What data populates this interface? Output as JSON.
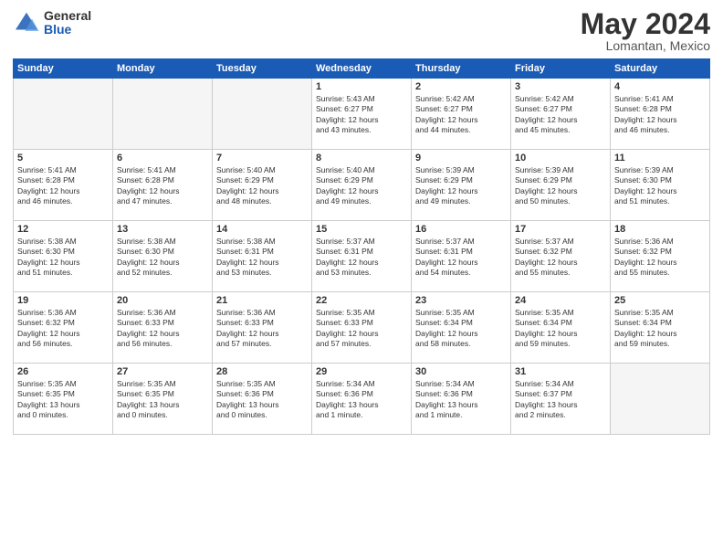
{
  "header": {
    "logo_general": "General",
    "logo_blue": "Blue",
    "title": "May 2024",
    "location": "Lomantan, Mexico"
  },
  "days_of_week": [
    "Sunday",
    "Monday",
    "Tuesday",
    "Wednesday",
    "Thursday",
    "Friday",
    "Saturday"
  ],
  "weeks": [
    [
      {
        "day": "",
        "info": ""
      },
      {
        "day": "",
        "info": ""
      },
      {
        "day": "",
        "info": ""
      },
      {
        "day": "1",
        "info": "Sunrise: 5:43 AM\nSunset: 6:27 PM\nDaylight: 12 hours\nand 43 minutes."
      },
      {
        "day": "2",
        "info": "Sunrise: 5:42 AM\nSunset: 6:27 PM\nDaylight: 12 hours\nand 44 minutes."
      },
      {
        "day": "3",
        "info": "Sunrise: 5:42 AM\nSunset: 6:27 PM\nDaylight: 12 hours\nand 45 minutes."
      },
      {
        "day": "4",
        "info": "Sunrise: 5:41 AM\nSunset: 6:28 PM\nDaylight: 12 hours\nand 46 minutes."
      }
    ],
    [
      {
        "day": "5",
        "info": "Sunrise: 5:41 AM\nSunset: 6:28 PM\nDaylight: 12 hours\nand 46 minutes."
      },
      {
        "day": "6",
        "info": "Sunrise: 5:41 AM\nSunset: 6:28 PM\nDaylight: 12 hours\nand 47 minutes."
      },
      {
        "day": "7",
        "info": "Sunrise: 5:40 AM\nSunset: 6:29 PM\nDaylight: 12 hours\nand 48 minutes."
      },
      {
        "day": "8",
        "info": "Sunrise: 5:40 AM\nSunset: 6:29 PM\nDaylight: 12 hours\nand 49 minutes."
      },
      {
        "day": "9",
        "info": "Sunrise: 5:39 AM\nSunset: 6:29 PM\nDaylight: 12 hours\nand 49 minutes."
      },
      {
        "day": "10",
        "info": "Sunrise: 5:39 AM\nSunset: 6:29 PM\nDaylight: 12 hours\nand 50 minutes."
      },
      {
        "day": "11",
        "info": "Sunrise: 5:39 AM\nSunset: 6:30 PM\nDaylight: 12 hours\nand 51 minutes."
      }
    ],
    [
      {
        "day": "12",
        "info": "Sunrise: 5:38 AM\nSunset: 6:30 PM\nDaylight: 12 hours\nand 51 minutes."
      },
      {
        "day": "13",
        "info": "Sunrise: 5:38 AM\nSunset: 6:30 PM\nDaylight: 12 hours\nand 52 minutes."
      },
      {
        "day": "14",
        "info": "Sunrise: 5:38 AM\nSunset: 6:31 PM\nDaylight: 12 hours\nand 53 minutes."
      },
      {
        "day": "15",
        "info": "Sunrise: 5:37 AM\nSunset: 6:31 PM\nDaylight: 12 hours\nand 53 minutes."
      },
      {
        "day": "16",
        "info": "Sunrise: 5:37 AM\nSunset: 6:31 PM\nDaylight: 12 hours\nand 54 minutes."
      },
      {
        "day": "17",
        "info": "Sunrise: 5:37 AM\nSunset: 6:32 PM\nDaylight: 12 hours\nand 55 minutes."
      },
      {
        "day": "18",
        "info": "Sunrise: 5:36 AM\nSunset: 6:32 PM\nDaylight: 12 hours\nand 55 minutes."
      }
    ],
    [
      {
        "day": "19",
        "info": "Sunrise: 5:36 AM\nSunset: 6:32 PM\nDaylight: 12 hours\nand 56 minutes."
      },
      {
        "day": "20",
        "info": "Sunrise: 5:36 AM\nSunset: 6:33 PM\nDaylight: 12 hours\nand 56 minutes."
      },
      {
        "day": "21",
        "info": "Sunrise: 5:36 AM\nSunset: 6:33 PM\nDaylight: 12 hours\nand 57 minutes."
      },
      {
        "day": "22",
        "info": "Sunrise: 5:35 AM\nSunset: 6:33 PM\nDaylight: 12 hours\nand 57 minutes."
      },
      {
        "day": "23",
        "info": "Sunrise: 5:35 AM\nSunset: 6:34 PM\nDaylight: 12 hours\nand 58 minutes."
      },
      {
        "day": "24",
        "info": "Sunrise: 5:35 AM\nSunset: 6:34 PM\nDaylight: 12 hours\nand 59 minutes."
      },
      {
        "day": "25",
        "info": "Sunrise: 5:35 AM\nSunset: 6:34 PM\nDaylight: 12 hours\nand 59 minutes."
      }
    ],
    [
      {
        "day": "26",
        "info": "Sunrise: 5:35 AM\nSunset: 6:35 PM\nDaylight: 13 hours\nand 0 minutes."
      },
      {
        "day": "27",
        "info": "Sunrise: 5:35 AM\nSunset: 6:35 PM\nDaylight: 13 hours\nand 0 minutes."
      },
      {
        "day": "28",
        "info": "Sunrise: 5:35 AM\nSunset: 6:36 PM\nDaylight: 13 hours\nand 0 minutes."
      },
      {
        "day": "29",
        "info": "Sunrise: 5:34 AM\nSunset: 6:36 PM\nDaylight: 13 hours\nand 1 minute."
      },
      {
        "day": "30",
        "info": "Sunrise: 5:34 AM\nSunset: 6:36 PM\nDaylight: 13 hours\nand 1 minute."
      },
      {
        "day": "31",
        "info": "Sunrise: 5:34 AM\nSunset: 6:37 PM\nDaylight: 13 hours\nand 2 minutes."
      },
      {
        "day": "",
        "info": ""
      }
    ]
  ]
}
